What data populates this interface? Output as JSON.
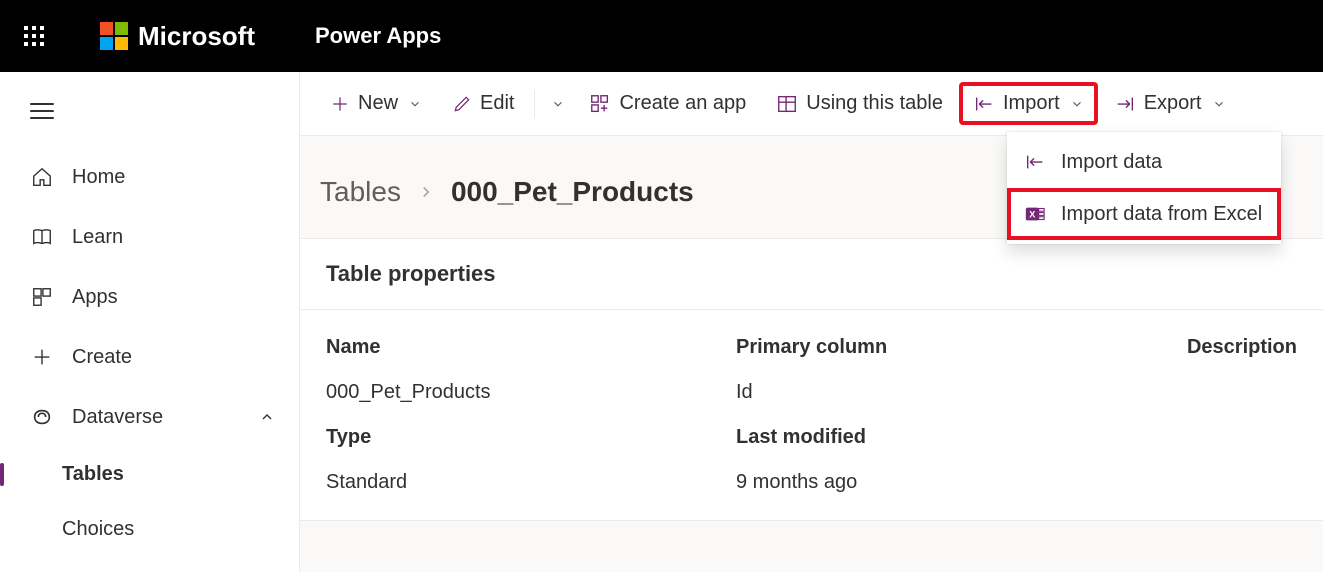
{
  "header": {
    "brand": "Microsoft",
    "app_title": "Power Apps"
  },
  "sidebar": {
    "items": [
      {
        "label": "Home"
      },
      {
        "label": "Learn"
      },
      {
        "label": "Apps"
      },
      {
        "label": "Create"
      },
      {
        "label": "Dataverse",
        "expanded": true
      }
    ],
    "sub_items": [
      {
        "label": "Tables",
        "active": true
      },
      {
        "label": "Choices"
      }
    ]
  },
  "command_bar": {
    "new": "New",
    "edit": "Edit",
    "create_app": "Create an app",
    "using_table": "Using this table",
    "import": "Import",
    "export": "Export"
  },
  "dropdown": {
    "item1": "Import data",
    "item2": "Import data from Excel"
  },
  "breadcrumb": {
    "parent": "Tables",
    "current": "000_Pet_Products"
  },
  "card": {
    "title": "Table properties",
    "labels": {
      "name": "Name",
      "primary_column": "Primary column",
      "description": "Description",
      "type": "Type",
      "last_modified": "Last modified"
    },
    "values": {
      "name": "000_Pet_Products",
      "primary_column": "Id",
      "type": "Standard",
      "last_modified": "9 months ago"
    }
  }
}
